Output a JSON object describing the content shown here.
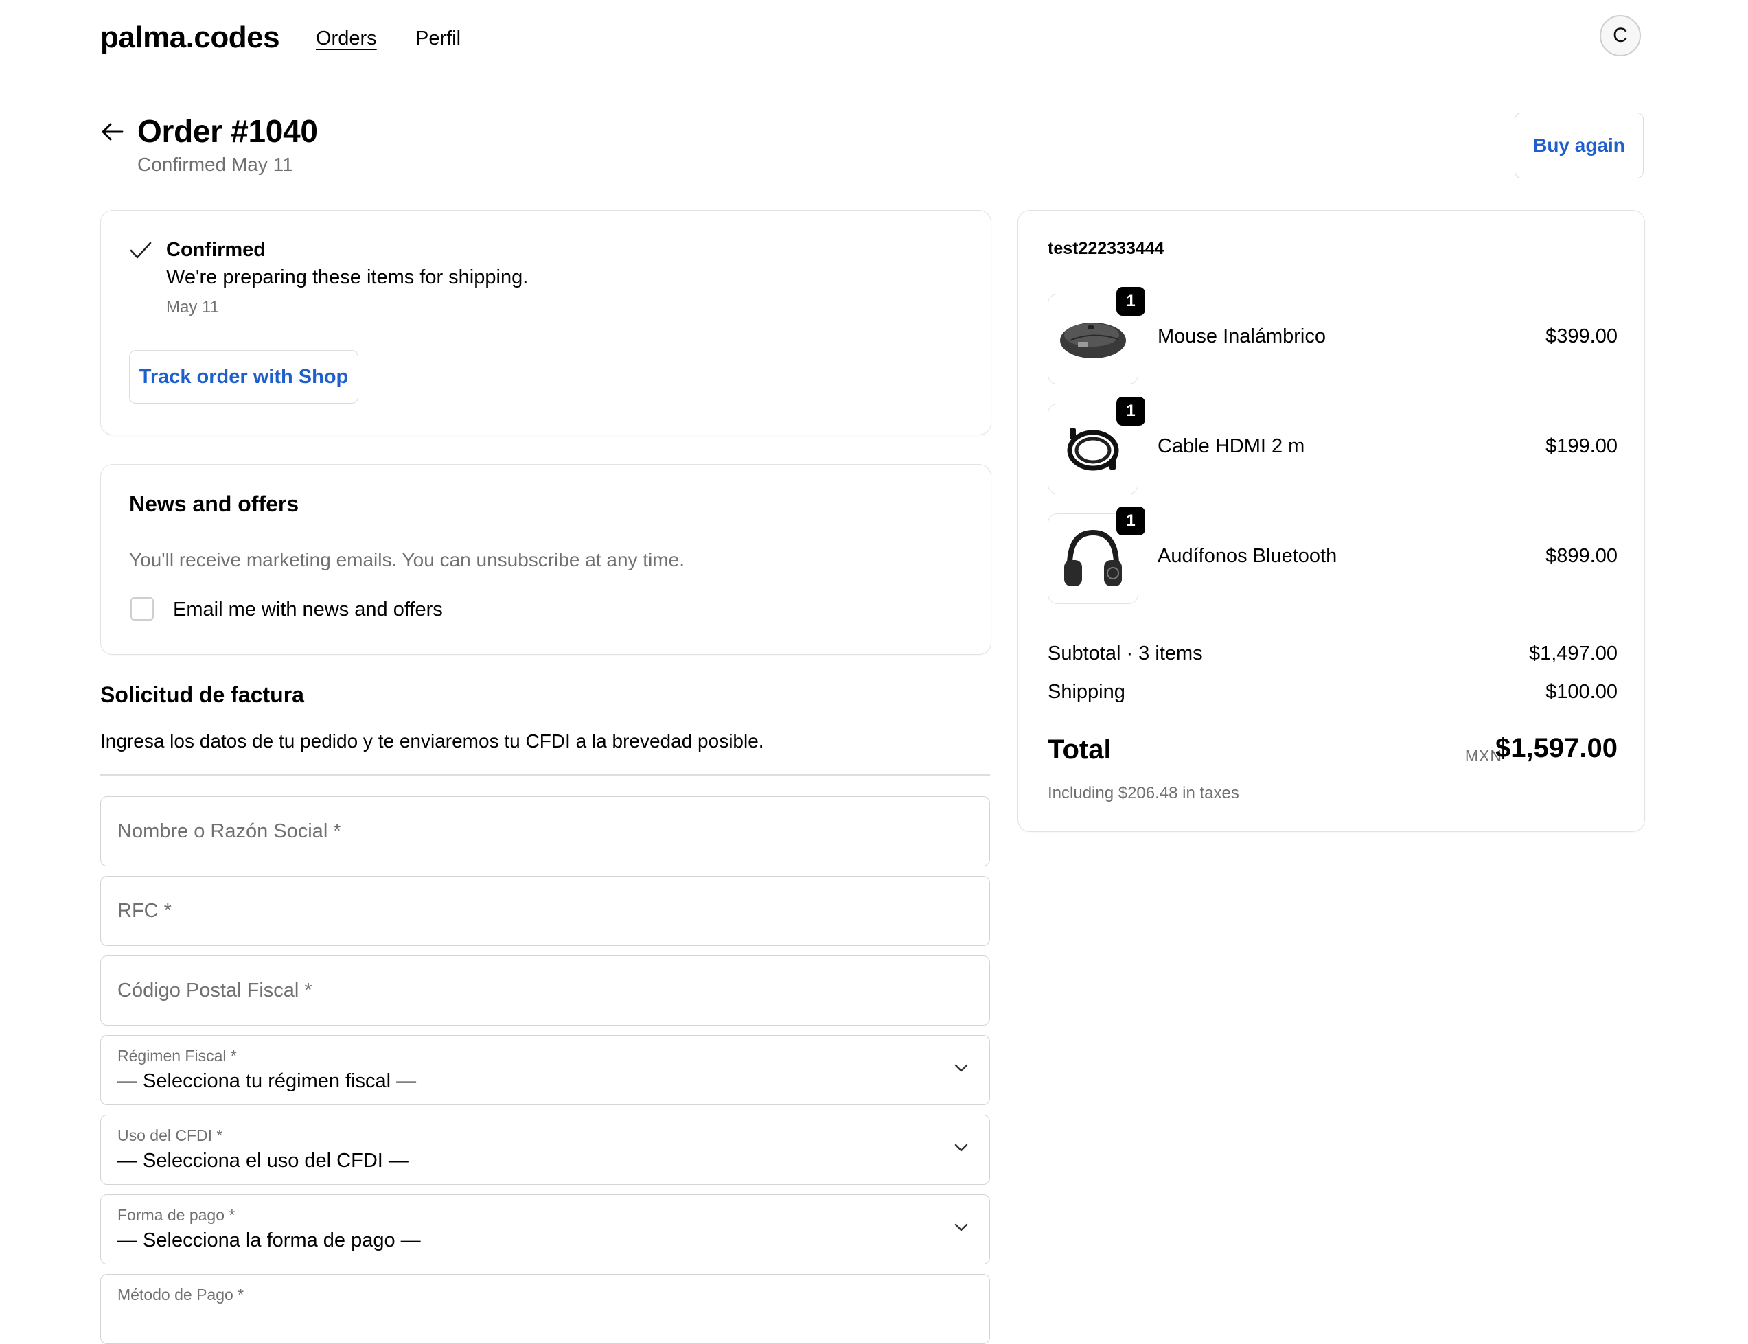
{
  "header": {
    "logo": "palma.codes",
    "nav": [
      {
        "label": "Orders"
      },
      {
        "label": "Perfil"
      }
    ],
    "avatar_initial": "C"
  },
  "order": {
    "title": "Order #1040",
    "subtitle": "Confirmed May 11",
    "buy_again": "Buy again"
  },
  "status": {
    "title": "Confirmed",
    "message": "We're preparing these items for shipping.",
    "date": "May 11",
    "track_button": "Track order with Shop"
  },
  "news": {
    "title": "News and offers",
    "description": "You'll receive marketing emails. You can unsubscribe at any time.",
    "checkbox_label": "Email me with news and offers",
    "checked": false
  },
  "invoice": {
    "title": "Solicitud de factura",
    "description": "Ingresa los datos de tu pedido y te enviaremos tu CFDI a la brevedad posible.",
    "inputs": [
      {
        "placeholder": "Nombre o Razón Social *"
      },
      {
        "placeholder": "RFC *"
      },
      {
        "placeholder": "Código Postal Fiscal *"
      }
    ],
    "selects": [
      {
        "label": "Régimen Fiscal *",
        "value": "— Selecciona tu régimen fiscal —"
      },
      {
        "label": "Uso del CFDI *",
        "value": "— Selecciona el uso del CFDI —"
      },
      {
        "label": "Forma de pago *",
        "value": "— Selecciona la forma de pago —"
      },
      {
        "label": "Método de Pago *",
        "value": ""
      }
    ]
  },
  "summary": {
    "store_name": "test222333444",
    "items": [
      {
        "name": "Mouse Inalámbrico",
        "price": "$399.00",
        "qty": "1",
        "icon": "mouse-icon"
      },
      {
        "name": "Cable HDMI 2 m",
        "price": "$199.00",
        "qty": "1",
        "icon": "cable-icon"
      },
      {
        "name": "Audífonos Bluetooth",
        "price": "$899.00",
        "qty": "1",
        "icon": "headphones-icon"
      }
    ],
    "subtotal_label": "Subtotal · 3 items",
    "subtotal": "$1,497.00",
    "shipping_label": "Shipping",
    "shipping": "$100.00",
    "total_label": "Total",
    "currency": "MXN",
    "total": "$1,597.00",
    "taxes_note": "Including $206.48 in taxes"
  },
  "colors": {
    "link_blue": "#1f5fcc",
    "border": "#e3e3e3",
    "muted_text": "#707070"
  }
}
